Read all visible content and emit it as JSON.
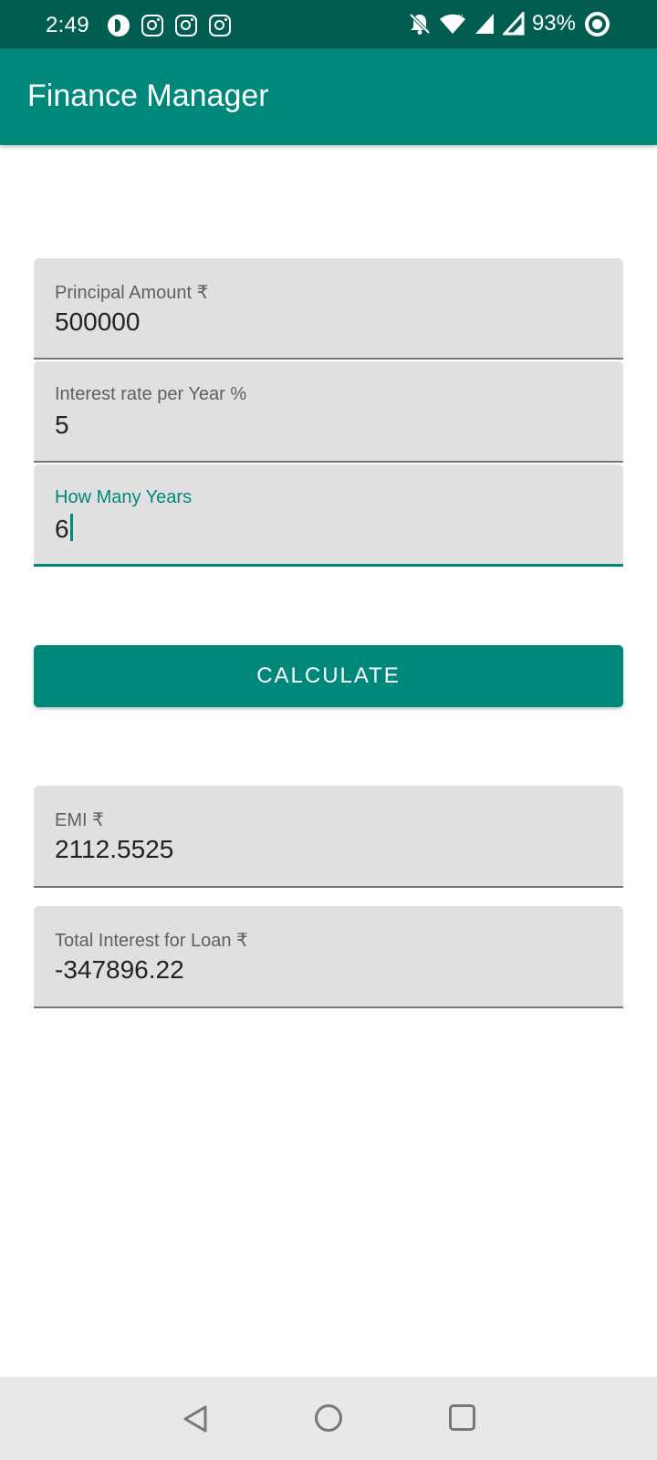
{
  "status": {
    "time": "2:49",
    "battery": "93%"
  },
  "app": {
    "title": "Finance Manager"
  },
  "form": {
    "principal": {
      "label": "Principal Amount ₹",
      "value": "500000"
    },
    "rate": {
      "label": "Interest rate per Year %",
      "value": "5"
    },
    "years": {
      "label": "How Many Years",
      "value": "6"
    }
  },
  "calculate_label": "CALCULATE",
  "results": {
    "emi": {
      "label": "EMI ₹",
      "value": "2112.5525"
    },
    "total_interest": {
      "label": "Total Interest for Loan ₹",
      "value": "-347896.22"
    }
  },
  "colors": {
    "status_bar": "#005d50",
    "primary": "#00897b",
    "field_bg": "#e0e0e0"
  },
  "icons": [
    "app-notification-icon",
    "instagram-icon",
    "bell-off-icon",
    "wifi-icon",
    "signal-icon",
    "battery-ring-icon",
    "back-icon",
    "home-icon",
    "recents-icon"
  ]
}
